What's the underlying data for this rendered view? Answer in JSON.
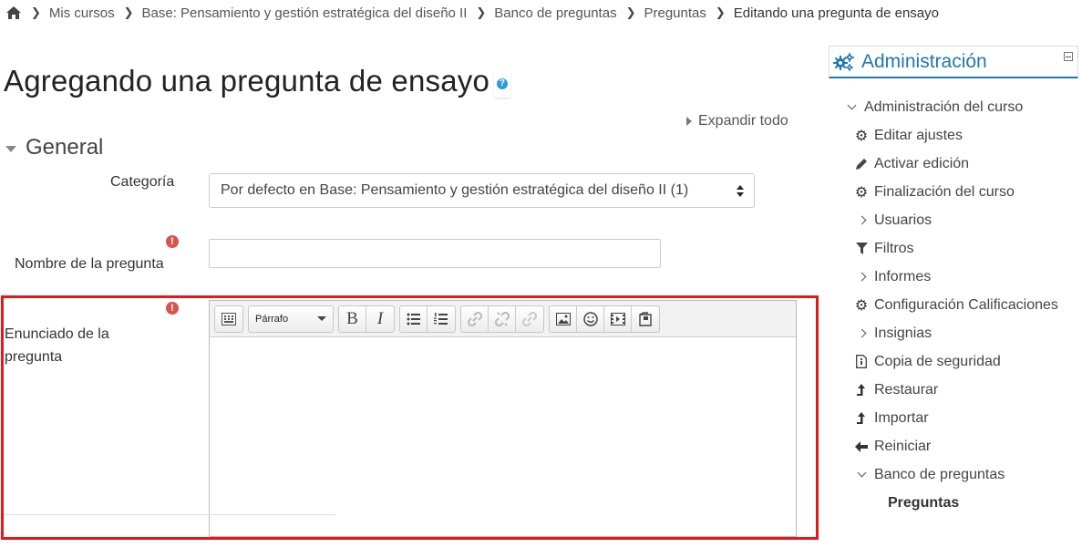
{
  "breadcrumb": {
    "home_icon": "home-icon",
    "items": [
      "Mis cursos",
      "Base: Pensamiento y gestión estratégica del diseño II",
      "Banco de preguntas",
      "Preguntas",
      "Editando una pregunta de ensayo"
    ]
  },
  "page": {
    "title": "Agregando una pregunta de ensayo",
    "help_icon_text": "?",
    "expand_all": "Expandir todo"
  },
  "form": {
    "section_general": "General",
    "category_label": "Categoría",
    "category_value": "Por defecto en Base: Pensamiento y gestión estratégica del diseño II (1)",
    "question_name_label": "Nombre de la pregunta",
    "question_name_value": "",
    "question_text_label_line1": "Enunciado de la",
    "question_text_label_line2": "pregunta",
    "required_icon_text": "!"
  },
  "editor": {
    "paragraph_style": "Párrafo",
    "bold": "B",
    "italic": "I"
  },
  "admin": {
    "title": "Administración",
    "course_admin": "Administración del curso",
    "items": [
      {
        "label": "Editar ajustes",
        "icon": "gear-icon"
      },
      {
        "label": "Activar edición",
        "icon": "pencil-icon"
      },
      {
        "label": "Finalización del curso",
        "icon": "gear-icon"
      },
      {
        "label": "Usuarios",
        "icon": "chevron-right-icon"
      },
      {
        "label": "Filtros",
        "icon": "filter-icon"
      },
      {
        "label": "Informes",
        "icon": "chevron-right-icon"
      },
      {
        "label": "Configuración Calificaciones",
        "icon": "gear-icon"
      },
      {
        "label": "Insignias",
        "icon": "chevron-right-icon"
      },
      {
        "label": "Copia de seguridad",
        "icon": "file-icon"
      },
      {
        "label": "Restaurar",
        "icon": "level-up-icon"
      },
      {
        "label": "Importar",
        "icon": "level-up-icon"
      },
      {
        "label": "Reiniciar",
        "icon": "arrow-left-icon"
      },
      {
        "label": "Banco de preguntas",
        "icon": "chevron-down-icon"
      }
    ],
    "question_bank_child": "Preguntas"
  },
  "colors": {
    "accent": "#1f77b4",
    "highlight": "#e0191b",
    "required": "#d9534f",
    "help": "#2a9fd6"
  }
}
